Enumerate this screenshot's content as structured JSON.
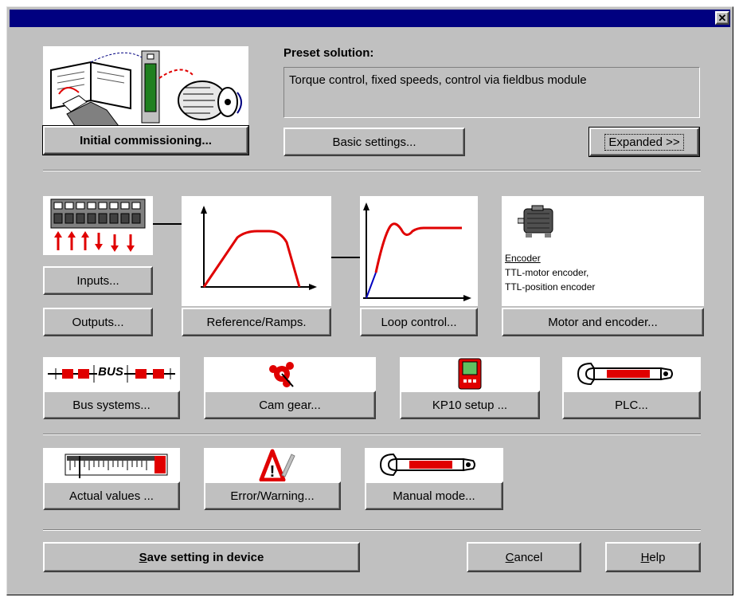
{
  "window": {
    "close_glyph": "✕"
  },
  "preset": {
    "label": "Preset solution:",
    "value": "Torque control, fixed speeds, control via fieldbus module"
  },
  "buttons": {
    "initial_commissioning": "Initial commissioning...",
    "basic_settings": "Basic settings...",
    "expanded": "Expanded >>",
    "inputs": "Inputs...",
    "outputs": "Outputs...",
    "reference_ramps": "Reference/Ramps.",
    "loop_control": "Loop control...",
    "motor_encoder": "Motor and encoder...",
    "bus_systems": "Bus systems...",
    "cam_gear": "Cam gear...",
    "kp10_setup": "KP10 setup ...",
    "plc": "PLC...",
    "actual_values": "Actual values ...",
    "error_warning": "Error/Warning...",
    "manual_mode": "Manual mode...",
    "save": {
      "pre": "",
      "ul": "S",
      "post": "ave setting in device"
    },
    "cancel": {
      "ul": "C",
      "post": "ancel"
    },
    "help": {
      "ul": "H",
      "post": "elp"
    }
  },
  "encoder": {
    "title": "Encoder",
    "line1": "TTL-motor encoder,",
    "line2": "TTL-position encoder"
  },
  "bus_icon_text": "BUS",
  "icons": {
    "commissioning": "commissioning-illustration-icon",
    "io_terminal": "io-terminal-icon",
    "ramp_graph": "reference-ramp-graph",
    "step_response": "loop-step-response-graph",
    "motor": "motor-icon",
    "bus": "bus-icon",
    "cam": "cam-gear-icon",
    "kp10": "kp10-keypad-icon",
    "wrench": "wrench-icon",
    "gauge": "actual-values-gauge-icon",
    "warning": "warning-triangle-icon"
  },
  "colors": {
    "title_bar": "#000080",
    "face": "#c0c0c0",
    "accent_red": "#e00000",
    "accent_blue": "#0000c0"
  }
}
